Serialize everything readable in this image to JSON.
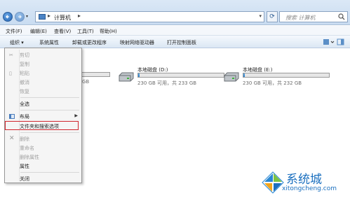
{
  "address_bar": {
    "crumb": "计算机",
    "separator": "▸",
    "search_placeholder": "搜索 计算机"
  },
  "menubar": {
    "items": [
      "文件(F)",
      "编辑(E)",
      "查看(V)",
      "工具(T)",
      "帮助(H)"
    ]
  },
  "toolbar": {
    "organize": "组织 ▾",
    "buttons": [
      "系统属性",
      "卸载或更改程序",
      "映射网络驱动器",
      "打开控制面板"
    ]
  },
  "drives": [
    {
      "name": "本地磁盘 (D:)",
      "size": "230 GB 可用，共 233 GB",
      "used_fraction": 0.02
    },
    {
      "name": "本地磁盘 (E:)",
      "size": "230 GB 可用，共 232 GB",
      "used_fraction": 0.02
    }
  ],
  "partial_drive": {
    "size": "GB"
  },
  "context_menu": {
    "items": [
      {
        "label": "剪切",
        "enabled": false
      },
      {
        "label": "复制",
        "enabled": false
      },
      {
        "label": "粘贴",
        "enabled": false
      },
      {
        "label": "撤消",
        "enabled": false
      },
      {
        "label": "恢复",
        "enabled": false
      },
      {
        "label": "全选",
        "enabled": true
      },
      {
        "label": "布局",
        "enabled": true,
        "submenu": true
      },
      {
        "label": "文件夹和搜索选项",
        "enabled": true,
        "highlighted": true
      },
      {
        "label": "删除",
        "enabled": false
      },
      {
        "label": "重命名",
        "enabled": false
      },
      {
        "label": "删除属性",
        "enabled": false
      },
      {
        "label": "属性",
        "enabled": true
      },
      {
        "label": "关闭",
        "enabled": true
      }
    ]
  },
  "watermark": {
    "brand": "系统城",
    "url": "xitongcheng.com"
  },
  "colors": {
    "highlight_box": "#d0262e",
    "accent": "#1a6fbf"
  }
}
